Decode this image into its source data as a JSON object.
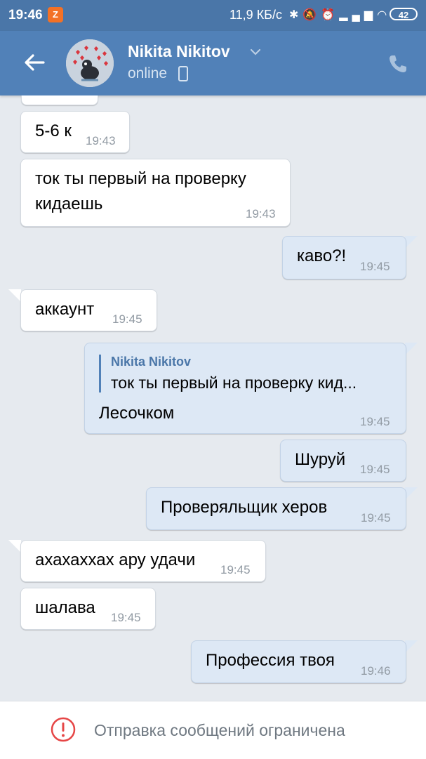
{
  "status_bar": {
    "time": "19:46",
    "notification_badge": "Z",
    "network_speed": "11,9 КБ/с",
    "icons": [
      "bluetooth-icon",
      "mute-icon",
      "alarm-icon",
      "signal-icon",
      "wifi-icon"
    ],
    "battery": "42"
  },
  "header": {
    "name": "Nikita Nikitov",
    "status": "online"
  },
  "messages": [
    {
      "direction": "in",
      "text": "5-6 к",
      "time": "19:43"
    },
    {
      "direction": "in",
      "text": "ток ты первый на проверку",
      "text2": "кидаешь",
      "time": "19:43"
    },
    {
      "direction": "out",
      "text": "каво?!",
      "time": "19:45"
    },
    {
      "direction": "in",
      "text": "аккаунт",
      "time": "19:45"
    },
    {
      "direction": "out",
      "quote_author": "Nikita Nikitov",
      "quote_text": "ток ты первый на проверку кид...",
      "text": "Лесочком",
      "time": "19:45"
    },
    {
      "direction": "out",
      "text": "Шуруй",
      "time": "19:45"
    },
    {
      "direction": "out",
      "text": "Проверяльщик херов",
      "time": "19:45"
    },
    {
      "direction": "in",
      "text": "ахахаххах ару удачи",
      "time": "19:45"
    },
    {
      "direction": "in",
      "text": "шалава",
      "time": "19:45"
    },
    {
      "direction": "out",
      "text": "Профессия твоя",
      "time": "19:46"
    }
  ],
  "footer": {
    "message": "Отправка сообщений ограничена"
  },
  "colors": {
    "header": "#5181b8",
    "status_bar": "#4a76a8",
    "background": "#e6eaef",
    "outgoing_bubble": "#dde8f5",
    "warning": "#e64646"
  }
}
